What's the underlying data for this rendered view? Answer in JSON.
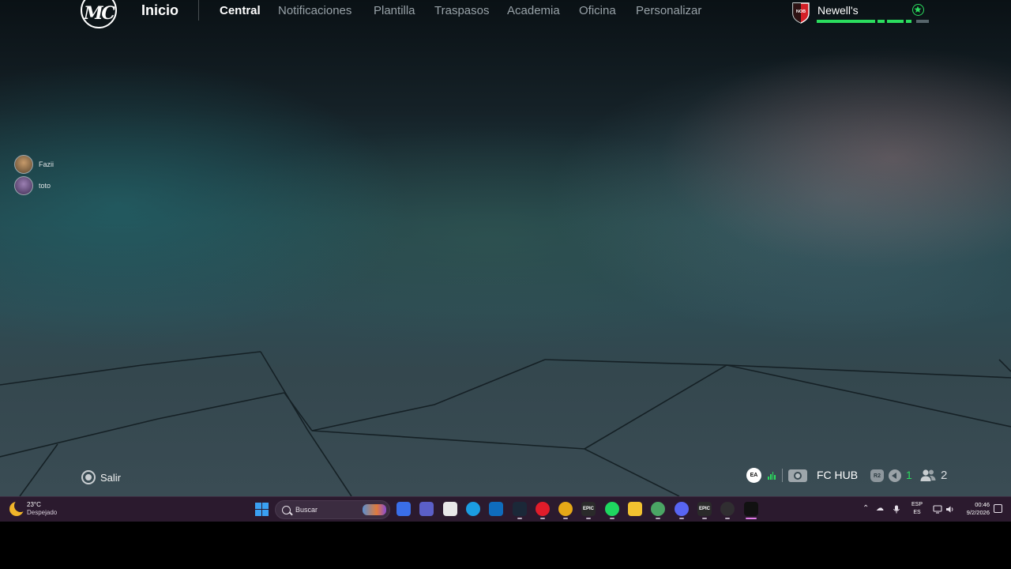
{
  "game": {
    "logo_text": "MC",
    "home_label": "Inicio",
    "tabs": [
      {
        "label": "Central",
        "active": true
      },
      {
        "label": "Notificaciones",
        "active": false
      },
      {
        "label": "Plantilla",
        "active": false
      },
      {
        "label": "Traspasos",
        "active": false
      },
      {
        "label": "Academia",
        "active": false
      },
      {
        "label": "Oficina",
        "active": false
      },
      {
        "label": "Personalizar",
        "active": false
      }
    ],
    "club": {
      "name": "Newell's",
      "crest_text": "NOB",
      "crest_colors": [
        "#d42027",
        "#111111"
      ],
      "star_icon": "star-icon",
      "progress_segments": 4,
      "accent_color": "#2bdc5e"
    },
    "friends": [
      {
        "name": "Fazii",
        "avatar_color": "#8c6b4a"
      },
      {
        "name": "toto",
        "avatar_color": "#6a4f7d"
      }
    ],
    "exit": {
      "button_glyph": "circle-button-icon",
      "label": "Salir"
    },
    "hud": {
      "ea_label": "EA",
      "hub_label": "FC HUB",
      "r2_label": "R2",
      "speaker_count": "1",
      "friends_count": "2"
    }
  },
  "taskbar": {
    "weather": {
      "temp": "23°C",
      "desc": "Despejado",
      "icon": "moon-icon"
    },
    "search_placeholder": "Buscar",
    "apps": [
      {
        "name": "copilot-icon",
        "color": "#3a6ee8",
        "label": ""
      },
      {
        "name": "teams-icon",
        "color": "#5b5fc7",
        "label": ""
      },
      {
        "name": "store-icon",
        "color": "#e8e8e8",
        "label": ""
      },
      {
        "name": "edge-icon",
        "color": "#1b9de2",
        "label": ""
      },
      {
        "name": "outlook-icon",
        "color": "#0f6cbd",
        "label": ""
      },
      {
        "name": "steam-icon",
        "color": "#1b2838",
        "label": ""
      },
      {
        "name": "opera-icon",
        "color": "#e11c2a",
        "label": ""
      },
      {
        "name": "chrome-icon",
        "color": "#e6a817",
        "label": ""
      },
      {
        "name": "epic-games-icon",
        "color": "#2a2a2a",
        "label": "EPIC"
      },
      {
        "name": "spotify-icon",
        "color": "#1ed760",
        "label": ""
      },
      {
        "name": "file-explorer-icon",
        "color": "#f2c230",
        "label": ""
      },
      {
        "name": "chrome-profile-icon",
        "color": "#4aa564",
        "label": ""
      },
      {
        "name": "discord-icon",
        "color": "#5865f2",
        "label": ""
      },
      {
        "name": "epic-launcher-icon",
        "color": "#2a2a2a",
        "label": "EPIC"
      },
      {
        "name": "obs-icon",
        "color": "#302e31",
        "label": ""
      },
      {
        "name": "ea-fc-icon",
        "color": "#111111",
        "label": ""
      }
    ],
    "tray": {
      "lang_top": "ESP",
      "lang_bottom": "ES",
      "time": "00:46",
      "date": "9/2/2026"
    }
  }
}
